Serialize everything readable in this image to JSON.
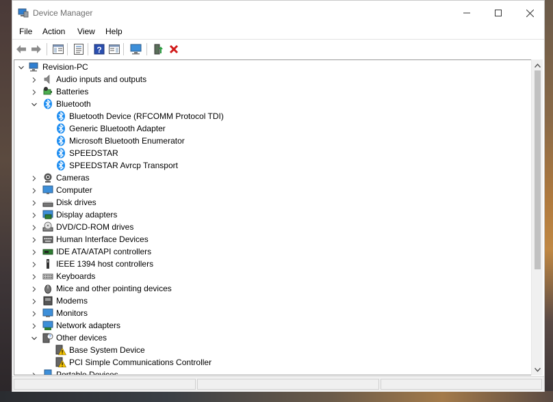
{
  "window": {
    "title": "Device Manager"
  },
  "menu": [
    "File",
    "Action",
    "View",
    "Help"
  ],
  "toolbar_icons": [
    "back-icon",
    "forward-icon",
    "show-hide-console-tree-icon",
    "properties-icon",
    "help-icon",
    "action-pane-icon",
    "scan-hardware-icon",
    "enable-device-icon",
    "uninstall-device-icon"
  ],
  "tree": {
    "root": "Revision-PC",
    "items": [
      {
        "label": "Audio inputs and outputs",
        "icon": "speaker-icon",
        "expanded": false,
        "level": 1
      },
      {
        "label": "Batteries",
        "icon": "battery-icon",
        "expanded": false,
        "level": 1
      },
      {
        "label": "Bluetooth",
        "icon": "bluetooth-icon",
        "expanded": true,
        "level": 1
      },
      {
        "label": "Bluetooth Device (RFCOMM Protocol TDI)",
        "icon": "bluetooth-icon",
        "level": 2
      },
      {
        "label": "Generic Bluetooth Adapter",
        "icon": "bluetooth-icon",
        "level": 2
      },
      {
        "label": "Microsoft Bluetooth Enumerator",
        "icon": "bluetooth-icon",
        "level": 2
      },
      {
        "label": "SPEEDSTAR",
        "icon": "bluetooth-icon",
        "level": 2
      },
      {
        "label": "SPEEDSTAR Avrcp Transport",
        "icon": "bluetooth-icon",
        "level": 2
      },
      {
        "label": "Cameras",
        "icon": "camera-icon",
        "expanded": false,
        "level": 1
      },
      {
        "label": "Computer",
        "icon": "computer-icon",
        "expanded": false,
        "level": 1
      },
      {
        "label": "Disk drives",
        "icon": "disk-drive-icon",
        "expanded": false,
        "level": 1
      },
      {
        "label": "Display adapters",
        "icon": "display-adapter-icon",
        "expanded": false,
        "level": 1
      },
      {
        "label": "DVD/CD-ROM drives",
        "icon": "dvd-drive-icon",
        "expanded": false,
        "level": 1
      },
      {
        "label": "Human Interface Devices",
        "icon": "hid-icon",
        "expanded": false,
        "level": 1
      },
      {
        "label": "IDE ATA/ATAPI controllers",
        "icon": "ide-controller-icon",
        "expanded": false,
        "level": 1
      },
      {
        "label": "IEEE 1394 host controllers",
        "icon": "ieee1394-icon",
        "expanded": false,
        "level": 1
      },
      {
        "label": "Keyboards",
        "icon": "keyboard-icon",
        "expanded": false,
        "level": 1
      },
      {
        "label": "Mice and other pointing devices",
        "icon": "mouse-icon",
        "expanded": false,
        "level": 1
      },
      {
        "label": "Modems",
        "icon": "modem-icon",
        "expanded": false,
        "level": 1
      },
      {
        "label": "Monitors",
        "icon": "monitor-icon",
        "expanded": false,
        "level": 1
      },
      {
        "label": "Network adapters",
        "icon": "network-adapter-icon",
        "expanded": false,
        "level": 1
      },
      {
        "label": "Other devices",
        "icon": "other-devices-icon",
        "expanded": true,
        "level": 1
      },
      {
        "label": "Base System Device",
        "icon": "warning-device-icon",
        "level": 2
      },
      {
        "label": "PCI Simple Communications Controller",
        "icon": "warning-device-icon",
        "level": 2
      },
      {
        "label": "Portable Devices",
        "icon": "portable-device-icon",
        "expanded": false,
        "level": 1
      }
    ]
  },
  "colors": {
    "bluetooth": "#1f8ef1",
    "accent": "#1e6fd9",
    "warning": "#f5c400",
    "uninstall_red": "#d11a1a"
  }
}
